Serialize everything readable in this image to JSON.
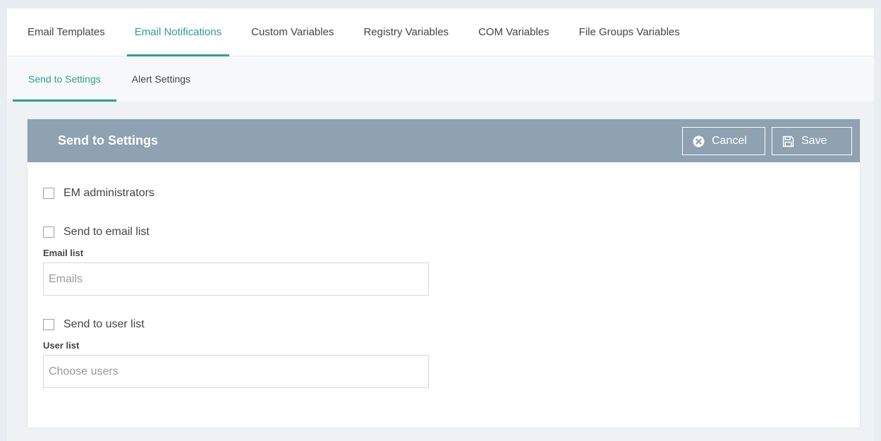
{
  "main_tabs": [
    {
      "label": "Email Templates"
    },
    {
      "label": "Email Notifications"
    },
    {
      "label": "Custom Variables"
    },
    {
      "label": "Registry Variables"
    },
    {
      "label": "COM Variables"
    },
    {
      "label": "File Groups Variables"
    }
  ],
  "main_tabs_active": "Email Notifications",
  "sub_tabs": [
    {
      "label": "Send to Settings"
    },
    {
      "label": "Alert Settings"
    }
  ],
  "sub_tabs_active": "Send to Settings",
  "panel": {
    "title": "Send to Settings",
    "cancel_label": "Cancel",
    "cancel_icon": "times-circle-icon",
    "save_label": "Save",
    "save_icon": "floppy-disk-icon"
  },
  "form": {
    "em_admins_label": "EM administrators",
    "em_admins_checked": false,
    "send_email_label": "Send to email list",
    "send_email_checked": false,
    "email_list_label": "Email list",
    "email_list_placeholder": "Emails",
    "email_list_value": "",
    "send_user_label": "Send to user list",
    "send_user_checked": false,
    "user_list_label": "User list",
    "user_list_placeholder": "Choose users",
    "user_list_value": ""
  },
  "colors": {
    "accent": "#2f9e8c",
    "panel_header": "#8ea2b1",
    "background": "#eef2f5"
  }
}
